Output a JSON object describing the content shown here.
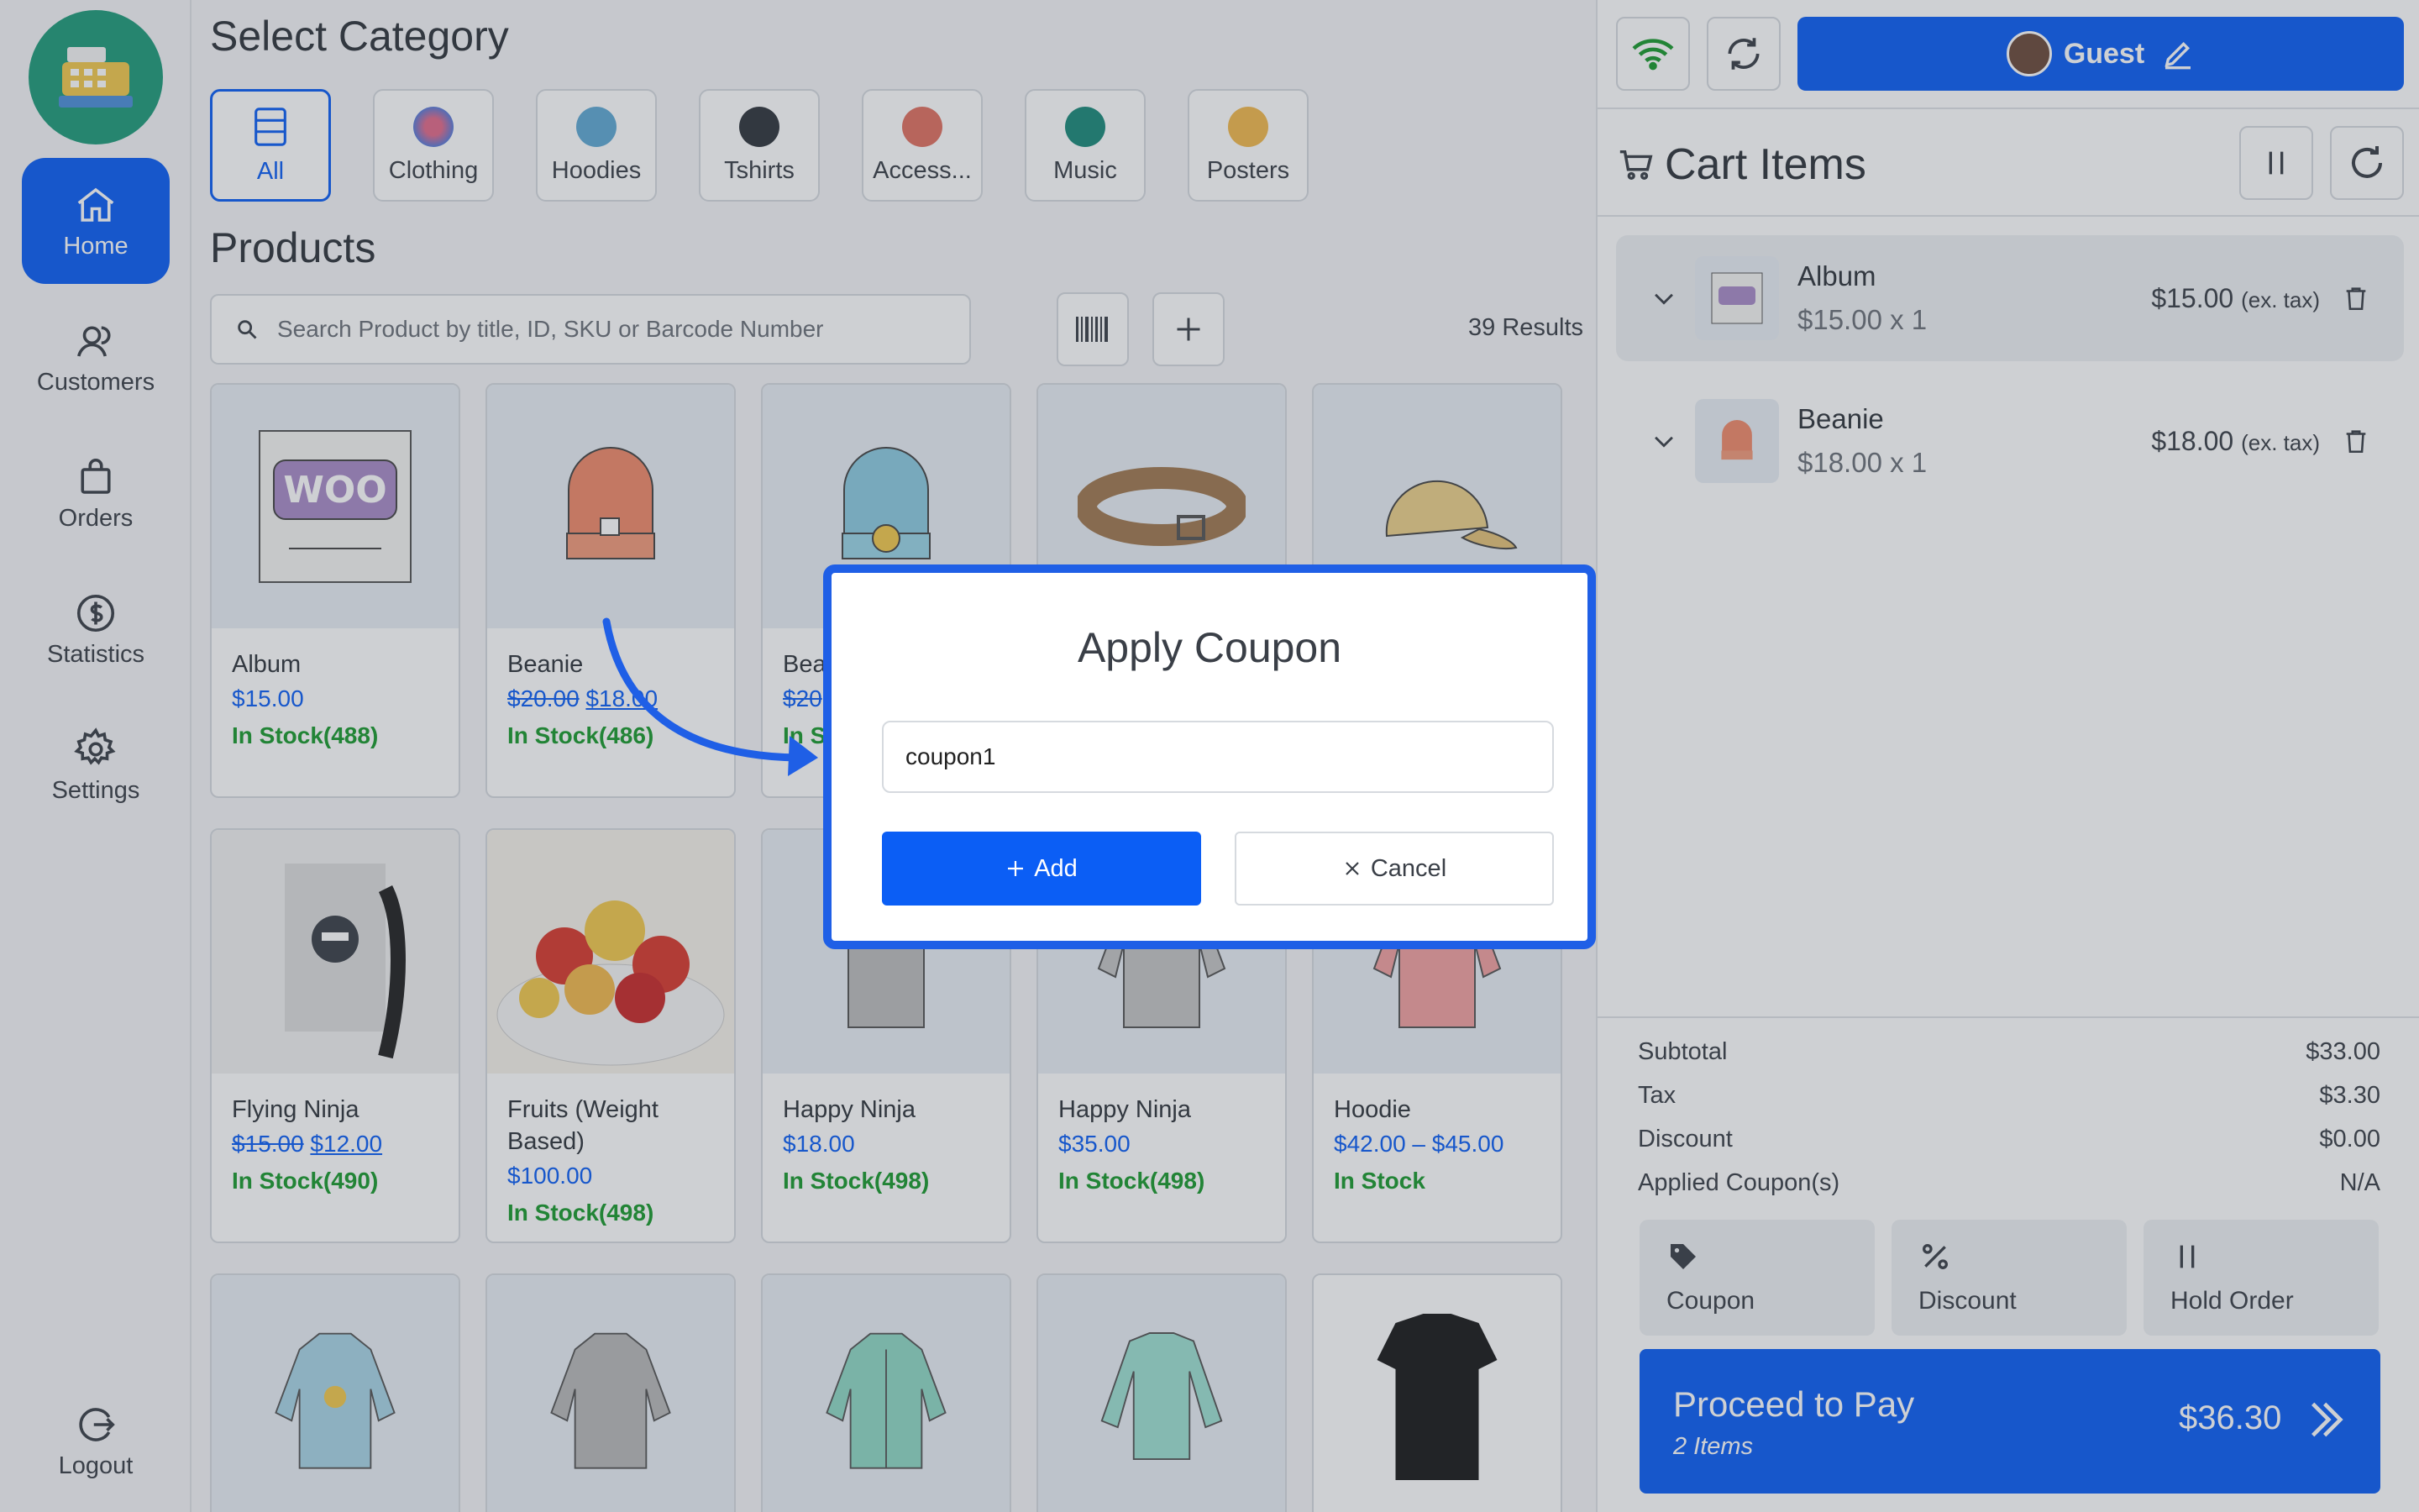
{
  "sidebar": {
    "items": [
      {
        "label": "Home",
        "icon": "home-icon"
      },
      {
        "label": "Customers",
        "icon": "customers-icon"
      },
      {
        "label": "Orders",
        "icon": "bag-icon"
      },
      {
        "label": "Statistics",
        "icon": "dollar-icon"
      },
      {
        "label": "Settings",
        "icon": "gear-icon"
      }
    ],
    "logout": "Logout"
  },
  "main": {
    "category_title": "Select Category",
    "categories": [
      {
        "label": "All"
      },
      {
        "label": "Clothing"
      },
      {
        "label": "Hoodies"
      },
      {
        "label": "Tshirts"
      },
      {
        "label": "Access..."
      },
      {
        "label": "Music"
      },
      {
        "label": "Posters"
      }
    ],
    "products_title": "Products",
    "search_placeholder": "Search Product by title, ID, SKU or Barcode Number",
    "results": "39 Results",
    "products": [
      {
        "name": "Album",
        "old_price": "",
        "price": "$15.00",
        "stock": "In Stock(488)"
      },
      {
        "name": "Beanie",
        "old_price": "$20.00",
        "price": "$18.00",
        "stock": "In Stock(486)"
      },
      {
        "name": "Bea",
        "old_price": "$20",
        "price": "",
        "stock": "In St"
      },
      {
        "name": "",
        "old_price": "",
        "price": "",
        "stock": ""
      },
      {
        "name": "",
        "old_price": "",
        "price": "",
        "stock": ""
      },
      {
        "name": "Flying Ninja",
        "old_price": "$15.00",
        "price": "$12.00",
        "stock": "In Stock(490)"
      },
      {
        "name": "Fruits (Weight Based)",
        "old_price": "",
        "price": "$100.00",
        "stock": "In Stock(498)"
      },
      {
        "name": "Happy Ninja",
        "old_price": "",
        "price": "$18.00",
        "stock": "In Stock(498)"
      },
      {
        "name": "Happy Ninja",
        "old_price": "",
        "price": "$35.00",
        "stock": "In Stock(498)"
      },
      {
        "name": "Hoodie",
        "old_price": "",
        "price": "$42.00 – $45.00",
        "stock": "In Stock"
      }
    ]
  },
  "cart": {
    "guest_label": "Guest",
    "title": "Cart Items",
    "items": [
      {
        "name": "Album",
        "qty": "$15.00 x 1",
        "price": "$15.00",
        "tax_note": "(ex. tax)"
      },
      {
        "name": "Beanie",
        "qty": "$18.00 x 1",
        "price": "$18.00",
        "tax_note": "(ex. tax)"
      }
    ],
    "summary": {
      "subtotal_label": "Subtotal",
      "subtotal": "$33.00",
      "tax_label": "Tax",
      "tax": "$3.30",
      "discount_label": "Discount",
      "discount": "$0.00",
      "coupons_label": "Applied Coupon(s)",
      "coupons": "N/A"
    },
    "actions": {
      "coupon": "Coupon",
      "discount": "Discount",
      "hold": "Hold Order"
    },
    "pay": {
      "label": "Proceed to Pay",
      "items": "2 Items",
      "total": "$36.30"
    }
  },
  "modal": {
    "title": "Apply Coupon",
    "input_value": "coupon1",
    "add_label": "Add",
    "cancel_label": "Cancel"
  },
  "colors": {
    "accent": "#0b5ef5",
    "stock": "#1a9a2e",
    "modal_border": "#1f5fe6"
  }
}
